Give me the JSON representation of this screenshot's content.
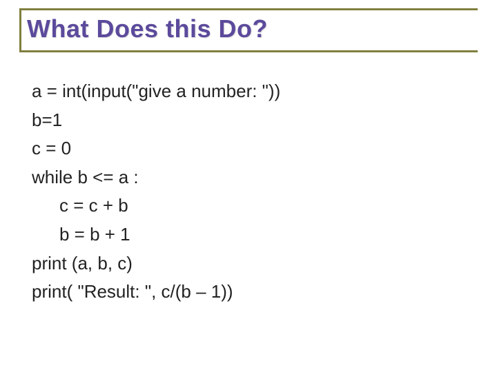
{
  "slide": {
    "title": "What Does this Do?",
    "lines": {
      "l0": "a = int(input(\"give a number: \"))",
      "l1": "b=1",
      "l2": "c = 0",
      "l3": "while b <= a :",
      "l4": "c = c + b",
      "l5": "b = b + 1",
      "l6": "print (a, b, c)",
      "l7": "print( \"Result: \", c/(b – 1))"
    }
  }
}
